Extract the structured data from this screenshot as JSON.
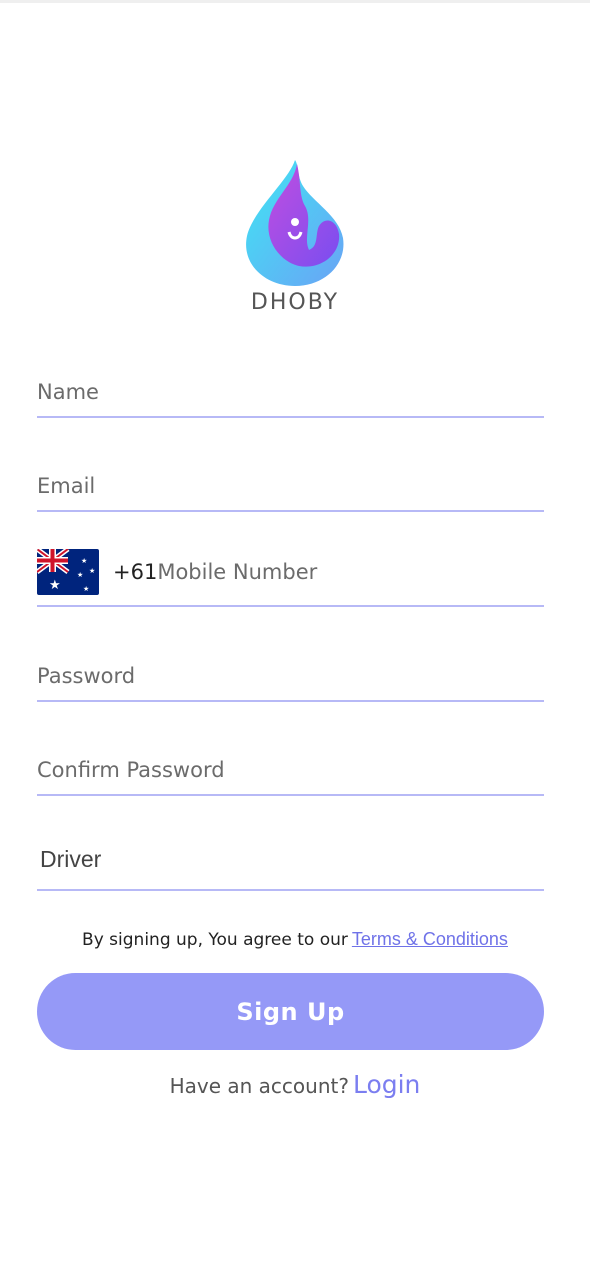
{
  "brand": {
    "name": "DHOBY"
  },
  "form": {
    "name_placeholder": "Name",
    "email_placeholder": "Email",
    "phone": {
      "country_flag": "australia-flag-icon",
      "dial_code": "+61",
      "placeholder": "Mobile Number"
    },
    "password_placeholder": "Password",
    "confirm_password_placeholder": "Confirm Password",
    "role_value": "Driver"
  },
  "terms": {
    "text": "By signing up, You agree to our",
    "link": "Terms & Conditions"
  },
  "signup_button": "Sign Up",
  "login": {
    "prompt": "Have an account?",
    "link": "Login"
  },
  "colors": {
    "accent": "#9599f7",
    "underline": "#b7b9f6",
    "link": "#6f72e8"
  }
}
